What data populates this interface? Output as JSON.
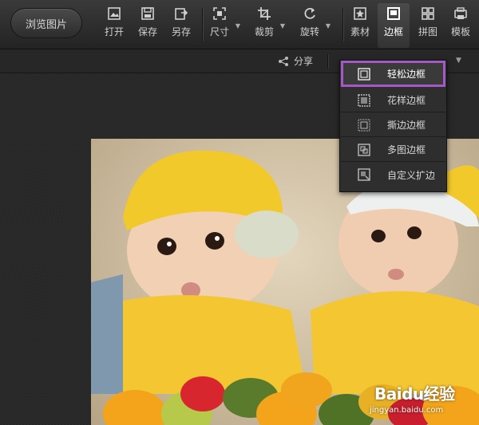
{
  "toolbar": {
    "browse_label": "浏览图片",
    "tools": [
      {
        "label": "打开",
        "icon": "open-icon"
      },
      {
        "label": "保存",
        "icon": "save-icon"
      },
      {
        "label": "另存",
        "icon": "save-as-icon"
      },
      {
        "label": "尺寸",
        "icon": "resize-icon"
      },
      {
        "label": "裁剪",
        "icon": "crop-icon"
      },
      {
        "label": "旋转",
        "icon": "rotate-icon"
      },
      {
        "label": "素材",
        "icon": "material-icon"
      },
      {
        "label": "边框",
        "icon": "border-icon",
        "active": true
      },
      {
        "label": "拼图",
        "icon": "collage-icon"
      },
      {
        "label": "模板",
        "icon": "template-icon"
      }
    ]
  },
  "subbar": {
    "share_label": "分享"
  },
  "border_menu": {
    "items": [
      {
        "label": "轻松边框",
        "icon": "simple-border-icon",
        "selected": true
      },
      {
        "label": "花样边框",
        "icon": "fancy-border-icon"
      },
      {
        "label": "撕边边框",
        "icon": "torn-border-icon"
      },
      {
        "label": "多图边框",
        "icon": "multi-photo-border-icon"
      },
      {
        "label": "自定义扩边",
        "icon": "custom-expand-icon"
      }
    ],
    "highlight_color": "#a45ac6"
  },
  "watermark": {
    "main": "Baidu经验",
    "sub": "jingyan.baidu.com"
  },
  "colors": {
    "toolbar_bg": "#2e2e2e",
    "menu_bg": "#2e2e2e",
    "highlight": "#a45ac6"
  }
}
